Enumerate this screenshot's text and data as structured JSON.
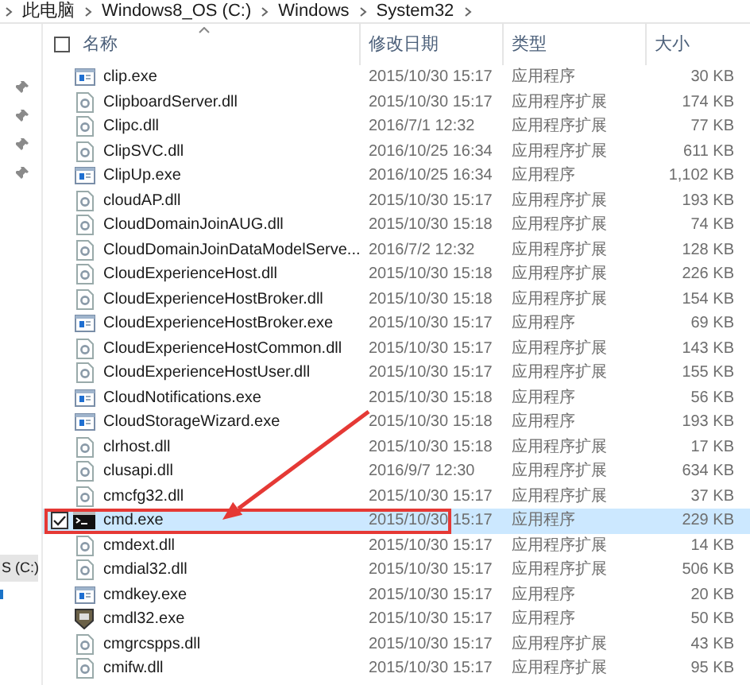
{
  "breadcrumb": [
    "此电脑",
    "Windows8_OS (C:)",
    "Windows",
    "System32"
  ],
  "navigation": {
    "drive_label": "S (C:)"
  },
  "select_all": {
    "checked": false
  },
  "columns": [
    {
      "label": "名称",
      "sorted": true
    },
    {
      "label": "修改日期",
      "sorted": false
    },
    {
      "label": "类型",
      "sorted": false
    },
    {
      "label": "大小",
      "sorted": false
    }
  ],
  "files": [
    {
      "name": "clip.exe",
      "date": "2015/10/30 15:17",
      "type": "应用程序",
      "size": "30 KB",
      "kind": "exe",
      "selected": false
    },
    {
      "name": "ClipboardServer.dll",
      "date": "2015/10/30 15:17",
      "type": "应用程序扩展",
      "size": "174 KB",
      "kind": "dll",
      "selected": false
    },
    {
      "name": "Clipc.dll",
      "date": "2016/7/1 12:32",
      "type": "应用程序扩展",
      "size": "77 KB",
      "kind": "dll",
      "selected": false
    },
    {
      "name": "ClipSVC.dll",
      "date": "2016/10/25 16:34",
      "type": "应用程序扩展",
      "size": "611 KB",
      "kind": "dll",
      "selected": false
    },
    {
      "name": "ClipUp.exe",
      "date": "2016/10/25 16:34",
      "type": "应用程序",
      "size": "1,102 KB",
      "kind": "exe",
      "selected": false
    },
    {
      "name": "cloudAP.dll",
      "date": "2015/10/30 15:17",
      "type": "应用程序扩展",
      "size": "193 KB",
      "kind": "dll",
      "selected": false
    },
    {
      "name": "CloudDomainJoinAUG.dll",
      "date": "2015/10/30 15:18",
      "type": "应用程序扩展",
      "size": "74 KB",
      "kind": "dll",
      "selected": false
    },
    {
      "name": "CloudDomainJoinDataModelServe...",
      "date": "2016/7/2 12:32",
      "type": "应用程序扩展",
      "size": "128 KB",
      "kind": "dll",
      "selected": false
    },
    {
      "name": "CloudExperienceHost.dll",
      "date": "2015/10/30 15:18",
      "type": "应用程序扩展",
      "size": "226 KB",
      "kind": "dll",
      "selected": false
    },
    {
      "name": "CloudExperienceHostBroker.dll",
      "date": "2015/10/30 15:18",
      "type": "应用程序扩展",
      "size": "154 KB",
      "kind": "dll",
      "selected": false
    },
    {
      "name": "CloudExperienceHostBroker.exe",
      "date": "2015/10/30 15:17",
      "type": "应用程序",
      "size": "69 KB",
      "kind": "exe",
      "selected": false
    },
    {
      "name": "CloudExperienceHostCommon.dll",
      "date": "2015/10/30 15:17",
      "type": "应用程序扩展",
      "size": "143 KB",
      "kind": "dll",
      "selected": false
    },
    {
      "name": "CloudExperienceHostUser.dll",
      "date": "2015/10/30 15:17",
      "type": "应用程序扩展",
      "size": "155 KB",
      "kind": "dll",
      "selected": false
    },
    {
      "name": "CloudNotifications.exe",
      "date": "2015/10/30 15:18",
      "type": "应用程序",
      "size": "56 KB",
      "kind": "exe",
      "selected": false
    },
    {
      "name": "CloudStorageWizard.exe",
      "date": "2015/10/30 15:18",
      "type": "应用程序",
      "size": "193 KB",
      "kind": "exe",
      "selected": false
    },
    {
      "name": "clrhost.dll",
      "date": "2015/10/30 15:18",
      "type": "应用程序扩展",
      "size": "17 KB",
      "kind": "dll",
      "selected": false
    },
    {
      "name": "clusapi.dll",
      "date": "2016/9/7 12:30",
      "type": "应用程序扩展",
      "size": "634 KB",
      "kind": "dll",
      "selected": false
    },
    {
      "name": "cmcfg32.dll",
      "date": "2015/10/30 15:17",
      "type": "应用程序扩展",
      "size": "37 KB",
      "kind": "dll",
      "selected": false
    },
    {
      "name": "cmd.exe",
      "date": "2015/10/30 15:17",
      "type": "应用程序",
      "size": "229 KB",
      "kind": "console",
      "selected": true
    },
    {
      "name": "cmdext.dll",
      "date": "2015/10/30 15:17",
      "type": "应用程序扩展",
      "size": "14 KB",
      "kind": "dll",
      "selected": false
    },
    {
      "name": "cmdial32.dll",
      "date": "2015/10/30 15:17",
      "type": "应用程序扩展",
      "size": "506 KB",
      "kind": "dll",
      "selected": false
    },
    {
      "name": "cmdkey.exe",
      "date": "2015/10/30 15:17",
      "type": "应用程序",
      "size": "20 KB",
      "kind": "exe",
      "selected": false
    },
    {
      "name": "cmdl32.exe",
      "date": "2015/10/30 15:17",
      "type": "应用程序",
      "size": "50 KB",
      "kind": "installer",
      "selected": false
    },
    {
      "name": "cmgrcspps.dll",
      "date": "2015/10/30 15:17",
      "type": "应用程序扩展",
      "size": "43 KB",
      "kind": "dll",
      "selected": false
    },
    {
      "name": "cmifw.dll",
      "date": "2015/10/30 15:17",
      "type": "应用程序扩展",
      "size": "95 KB",
      "kind": "dll",
      "selected": false
    }
  ],
  "annotations": {
    "arrow": true,
    "highlight_box": true
  }
}
